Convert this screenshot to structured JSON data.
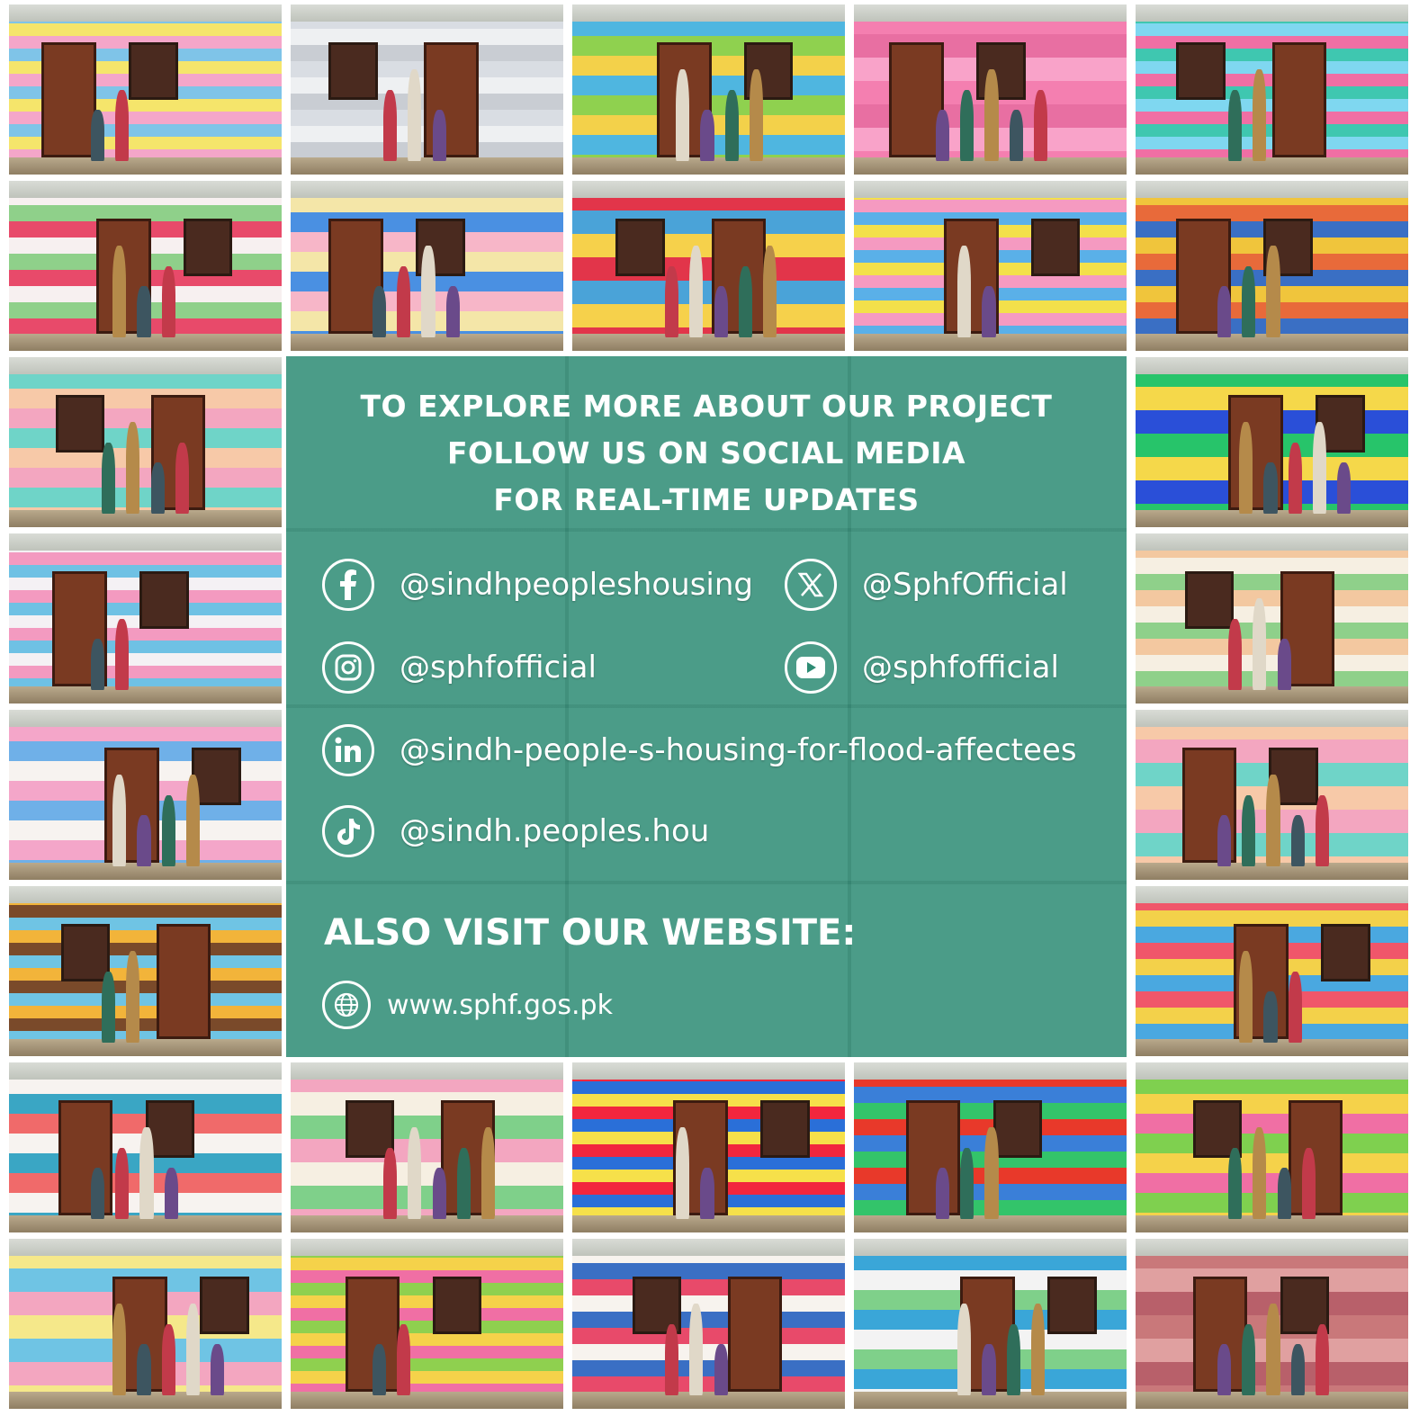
{
  "heading_lines": [
    "TO EXPLORE MORE ABOUT OUR PROJECT",
    "FOLLOW US ON SOCIAL MEDIA",
    "FOR REAL-TIME UPDATES"
  ],
  "socials": {
    "facebook": "@sindhpeopleshousing",
    "x": "@SphfOfficial",
    "instagram": "@sphfofficial",
    "youtube": "@sphfofficial",
    "linkedin": "@sindh-people-s-housing-for-flood-affectees",
    "tiktok": "@sindh.peoples.hou"
  },
  "website": {
    "title": "ALSO VISIT OUR WEBSITE:",
    "url": "www.sphf.gos.pk"
  },
  "icons": [
    "facebook-icon",
    "x-icon",
    "instagram-icon",
    "youtube-icon",
    "linkedin-icon",
    "tiktok-icon",
    "globe-icon"
  ],
  "colors": {
    "panel": "#2e8c74",
    "text": "#ffffff"
  }
}
